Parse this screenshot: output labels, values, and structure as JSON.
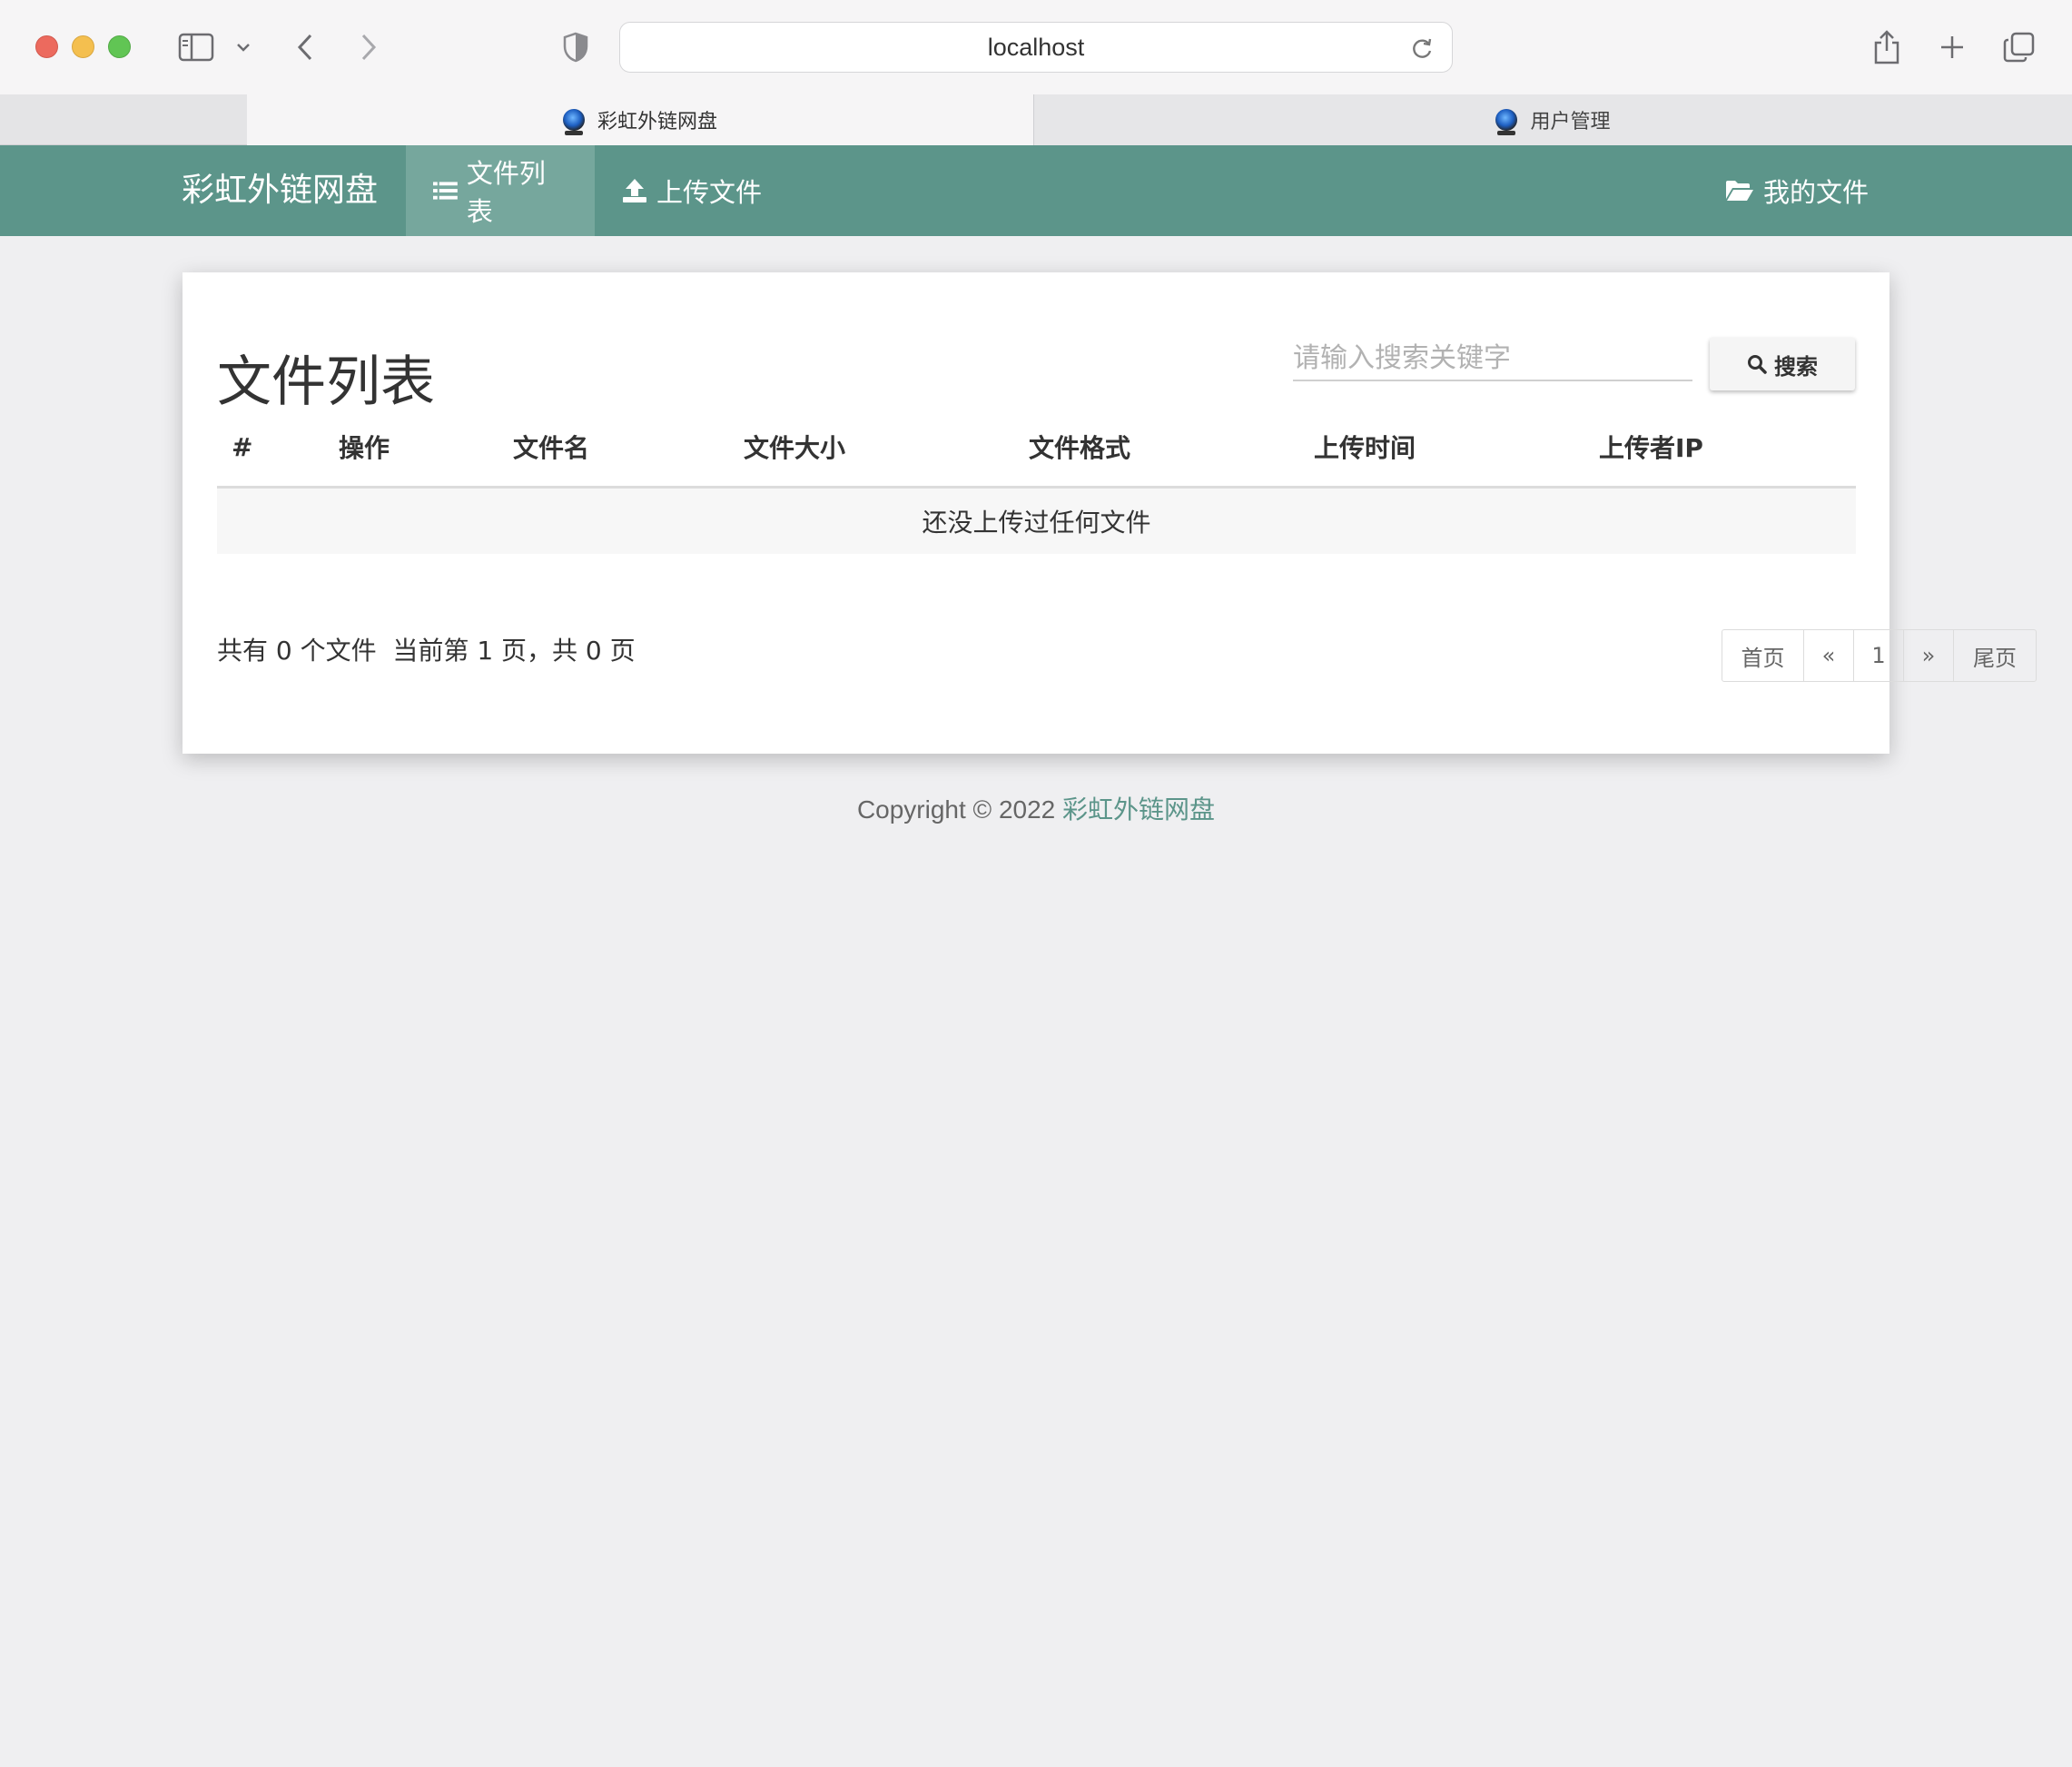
{
  "browser": {
    "url": "localhost",
    "tabs": [
      {
        "label": "彩虹外链网盘",
        "active": true
      },
      {
        "label": "用户管理",
        "active": false
      }
    ]
  },
  "navbar": {
    "brand": "彩虹外链网盘",
    "items": [
      {
        "label": "文件列表",
        "icon": "list-icon",
        "active": true
      },
      {
        "label": "上传文件",
        "icon": "upload-icon",
        "active": false
      }
    ],
    "right": {
      "label": "我的文件",
      "icon": "folder-open-icon"
    },
    "color": "#5c958a"
  },
  "main": {
    "title": "文件列表",
    "search": {
      "placeholder": "请输入搜索关键字",
      "value": "",
      "button_label": "搜索"
    },
    "table": {
      "columns": [
        "#",
        "操作",
        "文件名",
        "文件大小",
        "文件格式",
        "上传时间",
        "上传者IP"
      ],
      "empty_text": "还没上传过任何文件"
    },
    "summary": "共有 0 个文件  当前第 1 页，共 0 页",
    "pagination": [
      "首页",
      "«",
      "1",
      "»",
      "尾页"
    ]
  },
  "footer": {
    "text": "Copyright © 2022 ",
    "link": "彩虹外链网盘"
  }
}
